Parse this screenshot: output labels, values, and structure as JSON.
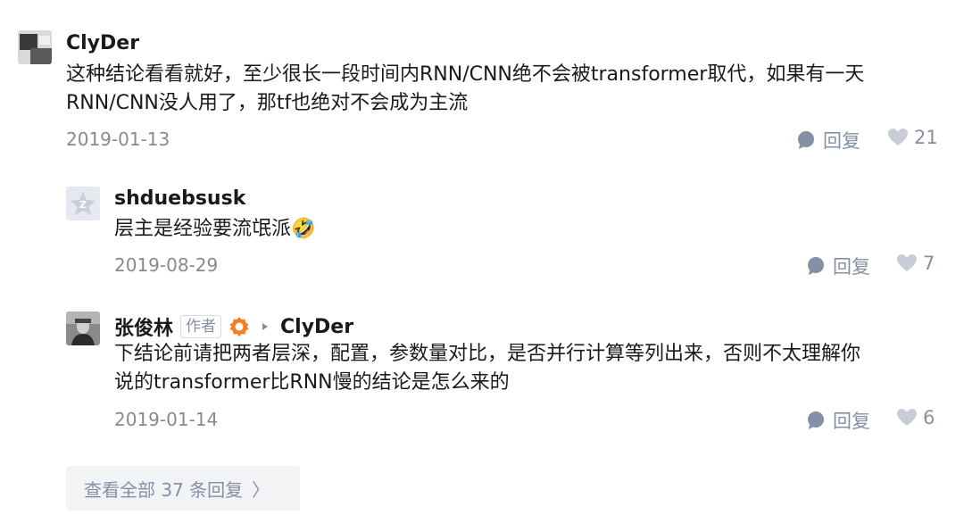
{
  "comments": [
    {
      "author": "ClyDer",
      "text_line1": "这种结论看看就好，至少很长一段时间内RNN/CNN绝不会被transformer取代，如果有一天",
      "text_line2": "RNN/CNN没人用了，那tf也绝对不会成为主流",
      "date": "2019-01-13",
      "reply_label": "回复",
      "likes": "21"
    },
    {
      "author": "shduebsusk",
      "text": "层主是经验要流氓派",
      "emoji": "🤣",
      "date": "2019-08-29",
      "reply_label": "回复",
      "likes": "7"
    },
    {
      "author": "张俊林",
      "author_badge": "作者",
      "reply_to": "ClyDer",
      "text_line1": "下结论前请把两者层深，配置，参数量对比，是否并行计算等列出来，否则不太理解你",
      "text_line2": "说的transformer比RNN慢的结论是怎么来的",
      "date": "2019-01-14",
      "reply_label": "回复",
      "likes": "6"
    }
  ],
  "more_replies": {
    "label": "查看全部 37 条回复",
    "chevron": "〉"
  },
  "colors": {
    "meta": "#8590a6",
    "date": "#8a8a8a",
    "author_verified_orange": "#ff7a1a"
  }
}
